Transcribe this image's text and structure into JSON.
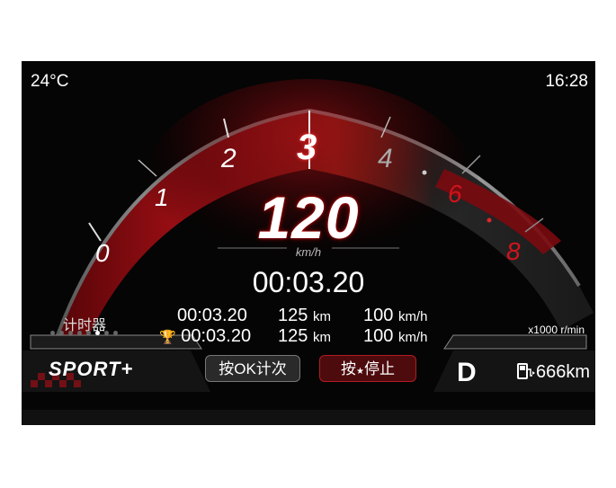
{
  "status": {
    "temperature": "24°C",
    "time": "16:28"
  },
  "tachometer": {
    "ticks": [
      "0",
      "1",
      "2",
      "3",
      "4",
      "6",
      "8"
    ],
    "rpm_unit": "x1000 r/min",
    "accent": "#d0141c"
  },
  "speed": {
    "value": "120",
    "unit": "km/h"
  },
  "timer": {
    "main": "00:03.20",
    "label": "计时器",
    "laps": [
      {
        "time": "00:03.20",
        "distance": "125",
        "distance_unit": "km",
        "speed": "100",
        "speed_unit": "km/h"
      },
      {
        "time": "00:03.20",
        "distance": "125",
        "distance_unit": "km",
        "speed": "100",
        "speed_unit": "km/h"
      }
    ],
    "page_dots": 8,
    "active_dot": 6
  },
  "mode": {
    "label": "SPORT+"
  },
  "buttons": {
    "lap": "按OK计次",
    "stop_prefix": "按",
    "stop_suffix": "停止"
  },
  "drive": {
    "gear": "D",
    "range": "666km"
  },
  "icons": {
    "trophy": "trophy-icon",
    "fuel": "fuel-pump-icon",
    "star": "star-icon"
  }
}
